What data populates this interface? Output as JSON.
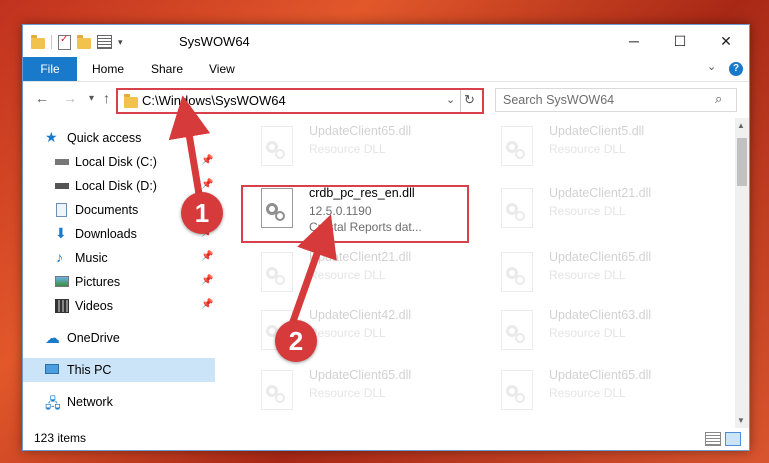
{
  "window": {
    "title": "SysWOW64"
  },
  "ribbon": {
    "file": "File",
    "tabs": [
      "Home",
      "Share",
      "View"
    ],
    "help": "?"
  },
  "address": {
    "path": "C:\\Windows\\SysWOW64"
  },
  "search": {
    "placeholder": "Search SysWOW64"
  },
  "sidebar": {
    "items": [
      {
        "label": "Quick access"
      },
      {
        "label": "Local Disk (C:)"
      },
      {
        "label": "Local Disk (D:)"
      },
      {
        "label": "Documents"
      },
      {
        "label": "Downloads"
      },
      {
        "label": "Music"
      },
      {
        "label": "Pictures"
      },
      {
        "label": "Videos"
      },
      {
        "label": "OneDrive"
      },
      {
        "label": "This PC"
      },
      {
        "label": "Network"
      }
    ]
  },
  "files": {
    "highlighted": {
      "name": "crdb_pc_res_en.dll",
      "version": "12.5.0.1190",
      "desc": "Crystal Reports dat..."
    },
    "ghosts": [
      {
        "name": "UpdateClient65.dll",
        "desc": "Resource DLL"
      },
      {
        "name": "UpdateClient5.dll",
        "desc": "Resource DLL"
      },
      {
        "name": "UpdateClient21.dll",
        "desc": "Resource DLL"
      },
      {
        "name": "UpdateClient21.dll",
        "desc": "Resource DLL"
      },
      {
        "name": "UpdateClient65.dll",
        "desc": "Resource DLL"
      },
      {
        "name": "UpdateClient42.dll",
        "desc": "Resource DLL"
      },
      {
        "name": "UpdateClient63.dll",
        "desc": "Resource DLL"
      },
      {
        "name": "UpdateClient65.dll",
        "desc": "Resource DLL"
      },
      {
        "name": "UpdateClient65.dll",
        "desc": "Resource DLL"
      }
    ]
  },
  "status": {
    "count": "123 items"
  },
  "markers": {
    "one": "1",
    "two": "2"
  },
  "colors": {
    "accent": "#1979ca",
    "highlight": "#d9414a",
    "marker": "#d63a3a"
  }
}
